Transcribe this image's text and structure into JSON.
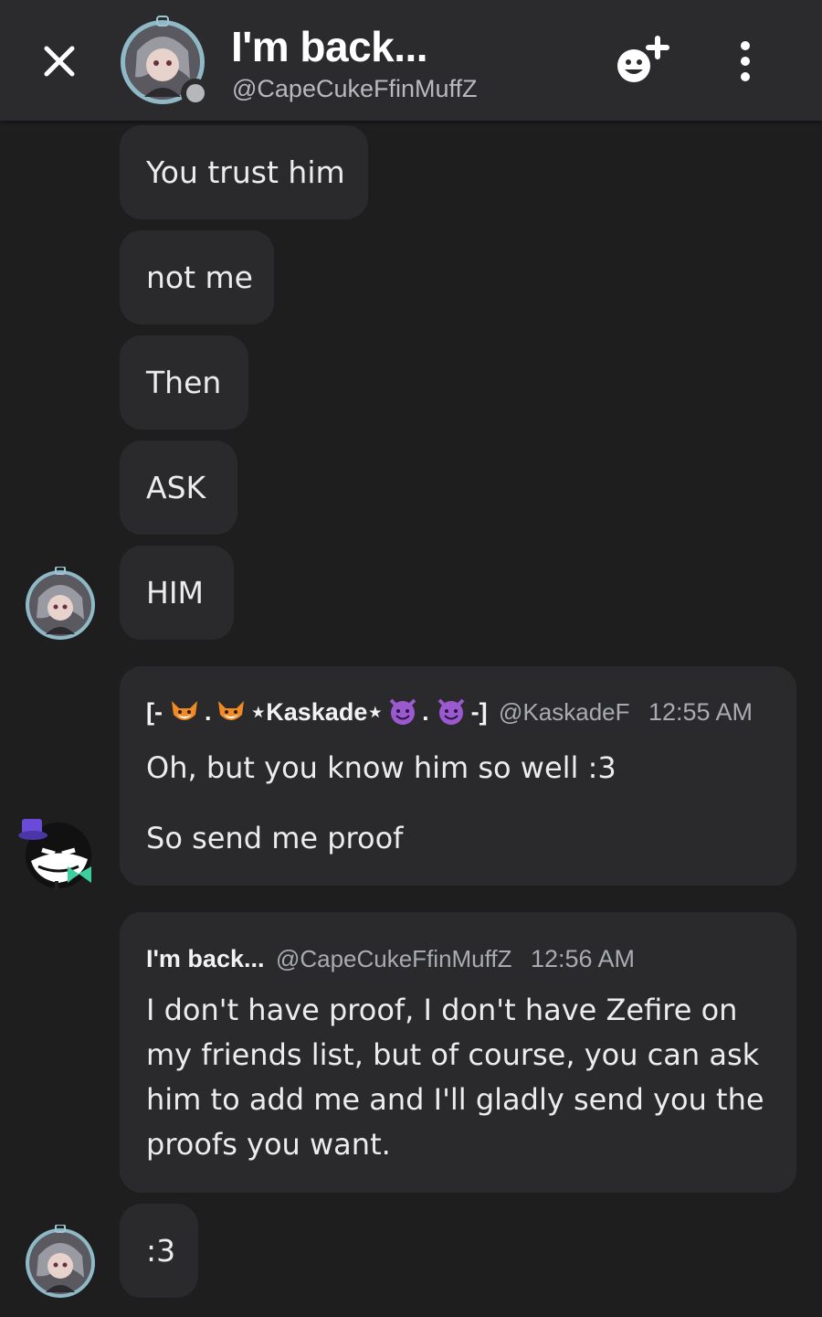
{
  "header": {
    "title": "I'm back...",
    "handle": "@CapeCukeFfinMuffZ"
  },
  "messages": [
    {
      "text": "You trust him"
    },
    {
      "text": "not me"
    },
    {
      "text": "Then"
    },
    {
      "text": "ASK"
    },
    {
      "text": "HIM"
    }
  ],
  "reply1": {
    "name_prefix": "[- ",
    "name_mid": " .",
    "name_core": "⋆Kaskade⋆",
    "name_dot": ". ",
    "name_end": "-]",
    "handle": "@KaskadeF",
    "time": "12:55 AM",
    "line1": "Oh, but you know him so well :3",
    "line2": "So send me proof"
  },
  "reply2": {
    "name": "I'm back...",
    "handle": "@CapeCukeFfinMuffZ",
    "time": "12:56 AM",
    "text": "I don't have proof, I don't have Zefire on my friends list, but of course, you can ask him to add me and I'll gladly send you the proofs you want."
  },
  "last_message": {
    "text": ":3"
  },
  "colors": {
    "background": "#1e1e1f",
    "header": "#2b2b2d",
    "bubble": "#2a2a2c",
    "status_offline": "#b5b7bb"
  },
  "icons": [
    "close-icon",
    "add-friend-icon",
    "more-vertical-icon",
    "fox-emoji",
    "smiling-devil-emoji"
  ]
}
